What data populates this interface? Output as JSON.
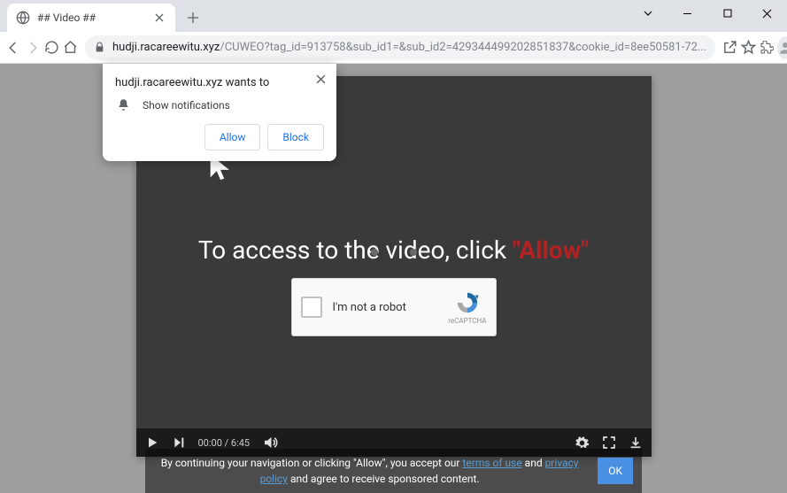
{
  "window": {
    "tab_title": "## Video ##"
  },
  "toolbar": {
    "url_host": "hudji.racareewitu.xyz",
    "url_path": "/CUWEO?tag_id=913758&sub_id1=&sub_id2=429344499202851837&cookie_id=8ee50581-72..."
  },
  "permission_prompt": {
    "header_text": "hudji.racareewitu.xyz wants to",
    "permission_label": "Show notifications",
    "allow_label": "Allow",
    "block_label": "Block"
  },
  "video": {
    "message_prefix": "To access to the video, click ",
    "message_allow": "\"Allow\"",
    "time": "00:00 / 6:45"
  },
  "recaptcha": {
    "label": "I'm not a robot",
    "brand": "reCAPTCHA"
  },
  "consent": {
    "text1": "By continuing your navigation or clicking \"Allow\", you accept our ",
    "terms_label": "terms of use",
    "text2": " and ",
    "privacy_label": "privacy policy",
    "text3": " and agree to receive sponsored content.",
    "ok_label": "OK"
  }
}
